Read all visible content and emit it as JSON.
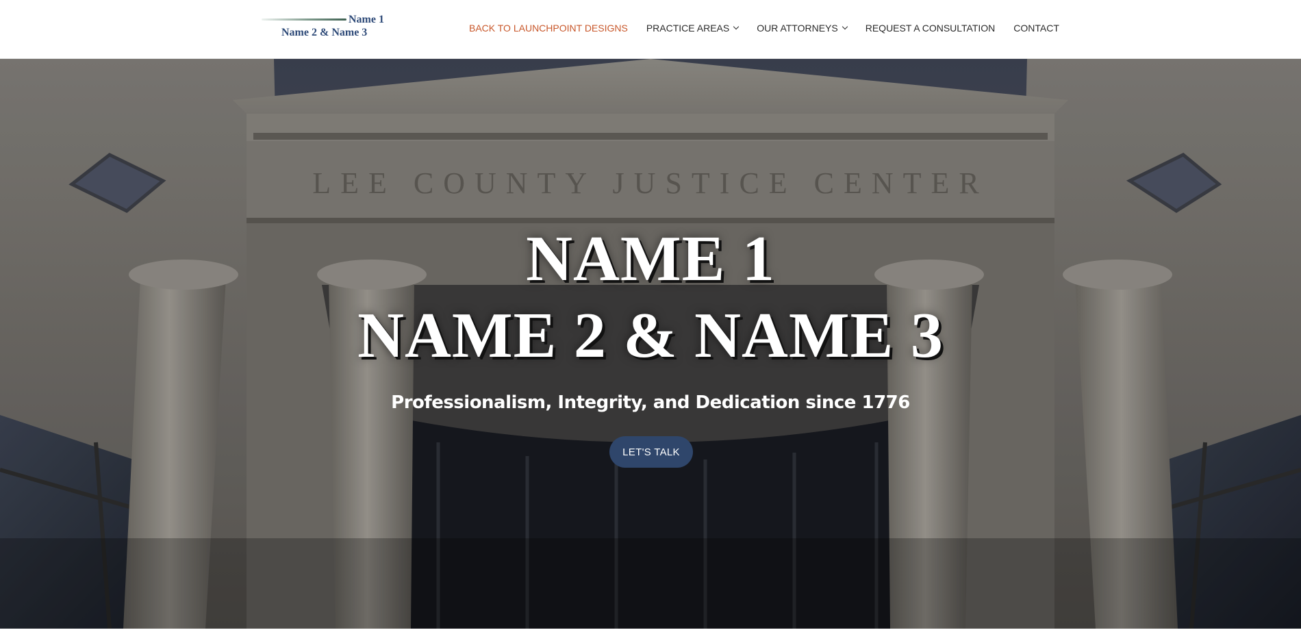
{
  "header": {
    "logo": {
      "name1": "Name 1",
      "name2": "Name 2 & Name 3"
    },
    "nav": [
      {
        "label": "BACK TO LAUNCHPOINT DESIGNS",
        "active": true
      },
      {
        "label": "PRACTICE AREAS",
        "dropdown": true
      },
      {
        "label": "OUR ATTORNEYS",
        "dropdown": true
      },
      {
        "label": "REQUEST A CONSULTATION"
      },
      {
        "label": "CONTACT"
      }
    ],
    "active_color": "#c8572a"
  },
  "hero": {
    "title_line1": "NAME 1",
    "title_line2": "NAME 2 & NAME 3",
    "tagline": "Professionalism, Integrity, and Dedication since 1776",
    "cta_label": "LET'S TALK",
    "cta_color": "#2f466b",
    "background": {
      "building_inscription": "LEE COUNTY JUSTICE CENTER",
      "icon": "courthouse-photo"
    }
  }
}
